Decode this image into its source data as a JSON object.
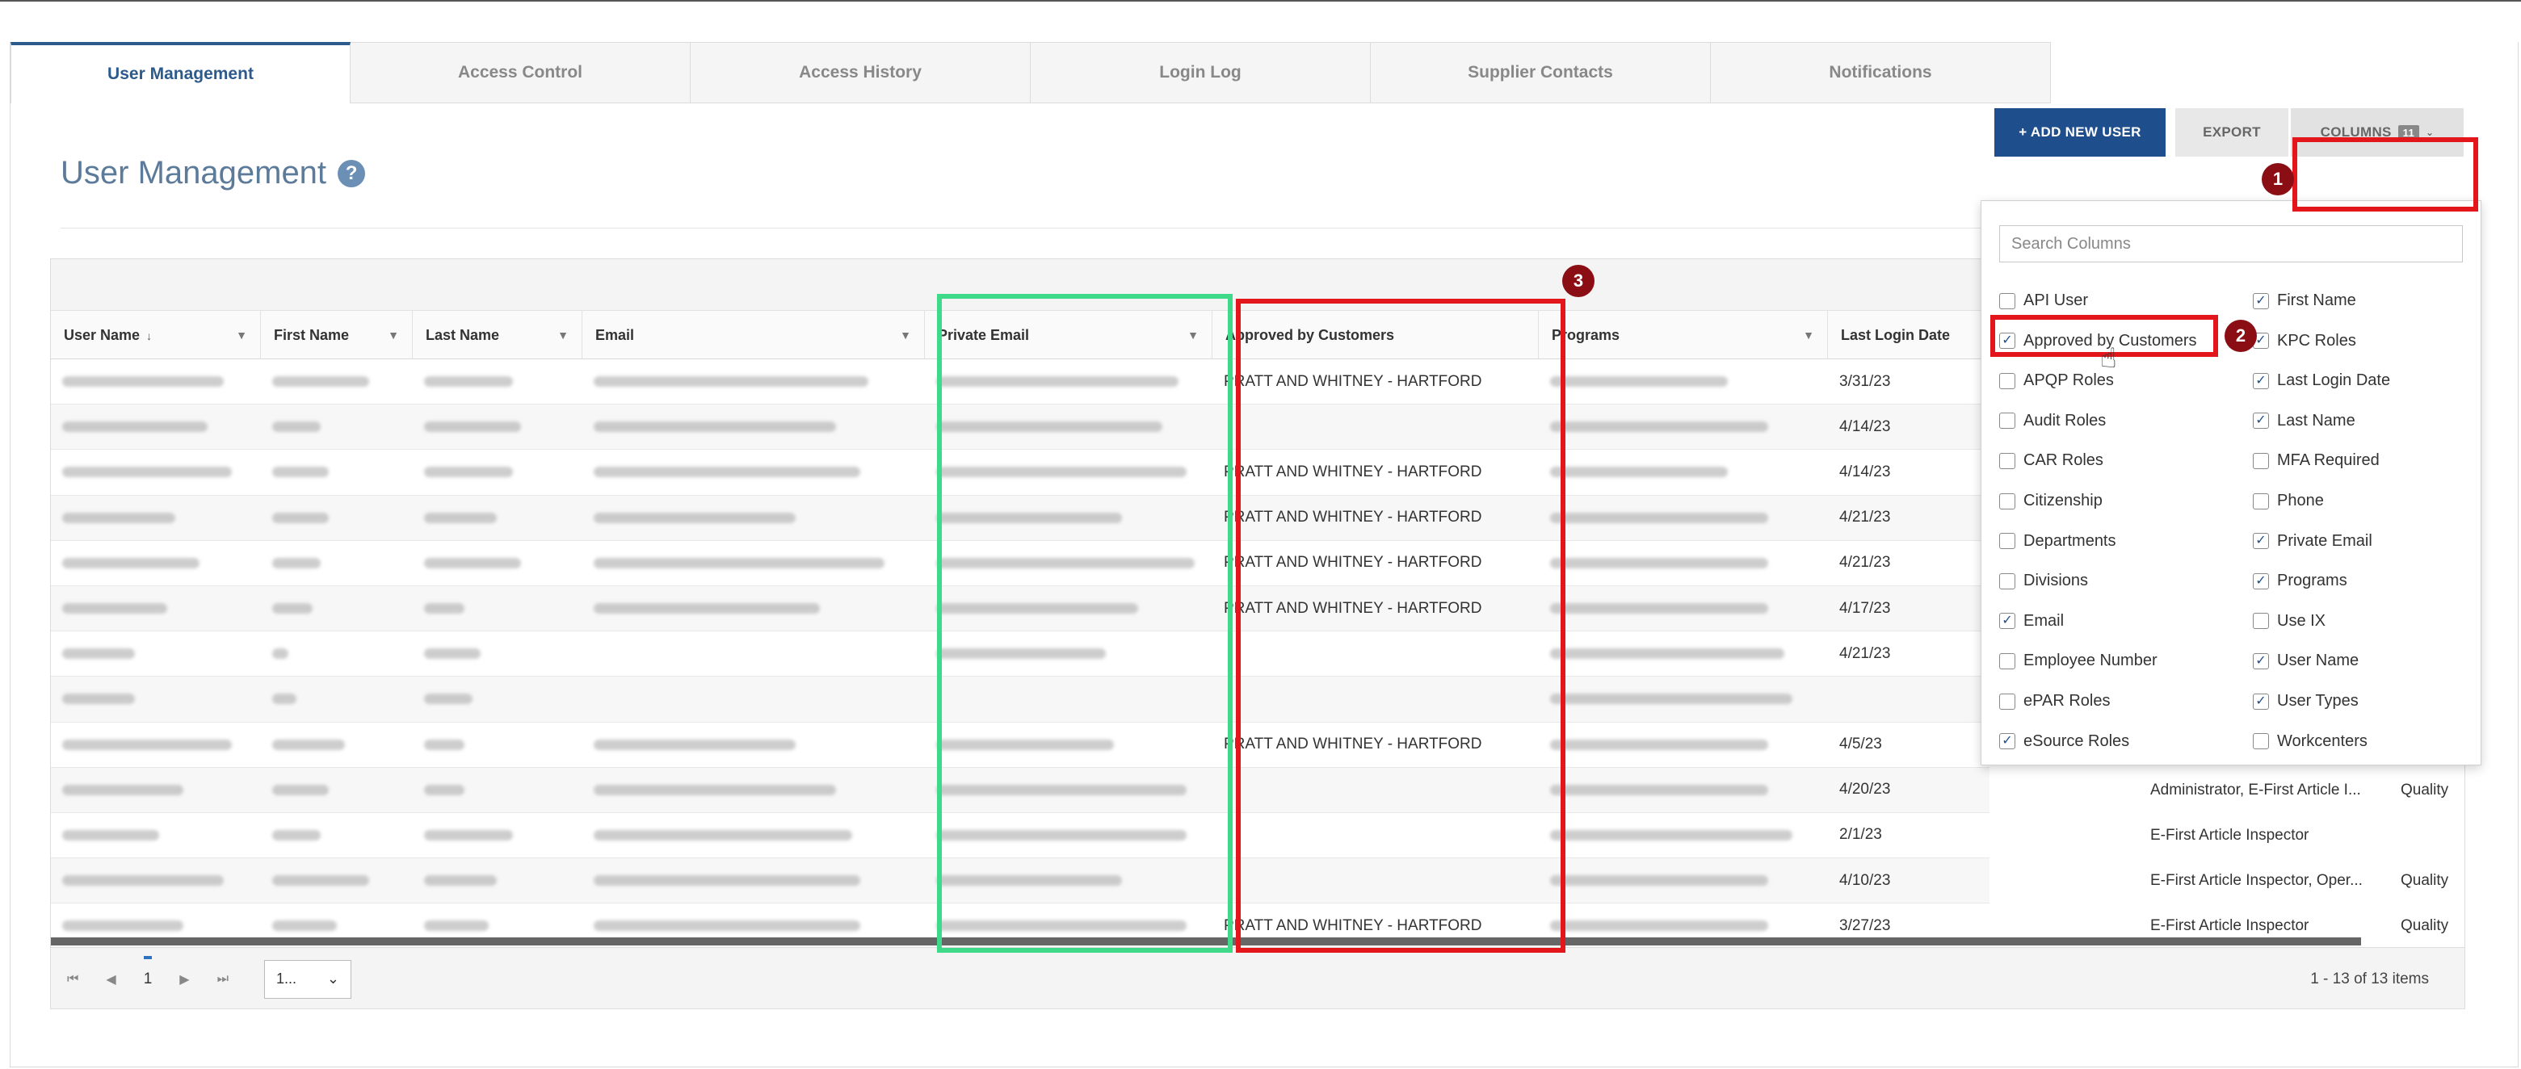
{
  "tabs": [
    {
      "label": "User Management",
      "active": true
    },
    {
      "label": "Access Control",
      "active": false
    },
    {
      "label": "Access History",
      "active": false
    },
    {
      "label": "Login Log",
      "active": false
    },
    {
      "label": "Supplier Contacts",
      "active": false
    },
    {
      "label": "Notifications",
      "active": false
    }
  ],
  "page": {
    "title": "User Management",
    "help_icon": "?"
  },
  "toolbar": {
    "add_label": "+ ADD NEW USER",
    "export_label": "EXPORT",
    "columns_label": "COLUMNS",
    "columns_count": "11",
    "caret": "⌄"
  },
  "markers": {
    "m1": "1",
    "m2": "2",
    "m3": "3"
  },
  "grid": {
    "headers": {
      "user_name": "User Name",
      "first_name": "First Name",
      "last_name": "Last Name",
      "email": "Email",
      "private_email": "Private Email",
      "approved_by_customers": "Approved by Customers",
      "programs": "Programs",
      "last_login_date": "Last Login Date"
    },
    "rows": [
      {
        "approved": "PRATT AND WHITNEY - HARTFORD",
        "last_login": "3/31/23"
      },
      {
        "approved": "",
        "last_login": "4/14/23"
      },
      {
        "approved": "PRATT AND WHITNEY - HARTFORD",
        "last_login": "4/14/23"
      },
      {
        "approved": "PRATT AND WHITNEY - HARTFORD",
        "last_login": "4/21/23"
      },
      {
        "approved": "PRATT AND WHITNEY - HARTFORD",
        "last_login": "4/21/23"
      },
      {
        "approved": "PRATT AND WHITNEY - HARTFORD",
        "last_login": "4/17/23"
      },
      {
        "approved": "",
        "last_login": "4/21/23"
      },
      {
        "approved": "",
        "last_login": ""
      },
      {
        "approved": "PRATT AND WHITNEY - HARTFORD",
        "last_login": "4/5/23"
      },
      {
        "approved": "",
        "last_login": "4/20/23",
        "user_types": "Administrator, E-First Article I...",
        "extra": "Quality"
      },
      {
        "approved": "",
        "last_login": "2/1/23",
        "user_types": "E-First Article Inspector",
        "extra": ""
      },
      {
        "approved": "",
        "last_login": "4/10/23",
        "user_types": "E-First Article Inspector, Oper...",
        "extra": "Quality"
      },
      {
        "approved": "PRATT AND WHITNEY - HARTFORD",
        "last_login": "3/27/23",
        "user_types": "E-First Article Inspector",
        "extra": "Quality"
      }
    ],
    "footer": {
      "first": "⏮",
      "prev": "◀",
      "page": "1",
      "next": "▶",
      "last": "⏭",
      "page_size": "1...",
      "page_size_caret": "⌄",
      "items": "1 - 13 of 13 items"
    }
  },
  "columns_panel": {
    "search_placeholder": "Search Columns",
    "left": [
      {
        "label": "API User",
        "checked": false
      },
      {
        "label": "Approved by Customers",
        "checked": true
      },
      {
        "label": "APQP Roles",
        "checked": false
      },
      {
        "label": "Audit Roles",
        "checked": false
      },
      {
        "label": "CAR Roles",
        "checked": false
      },
      {
        "label": "Citizenship",
        "checked": false
      },
      {
        "label": "Departments",
        "checked": false
      },
      {
        "label": "Divisions",
        "checked": false
      },
      {
        "label": "Email",
        "checked": true
      },
      {
        "label": "Employee Number",
        "checked": false
      },
      {
        "label": "ePAR Roles",
        "checked": false
      },
      {
        "label": "eSource Roles",
        "checked": true
      }
    ],
    "right": [
      {
        "label": "First Name",
        "checked": true
      },
      {
        "label": "KPC Roles",
        "checked": true
      },
      {
        "label": "Last Login Date",
        "checked": true
      },
      {
        "label": "Last Name",
        "checked": true
      },
      {
        "label": "MFA Required",
        "checked": false
      },
      {
        "label": "Phone",
        "checked": false
      },
      {
        "label": "Private Email",
        "checked": true
      },
      {
        "label": "Programs",
        "checked": true
      },
      {
        "label": "Use IX",
        "checked": false
      },
      {
        "label": "User Name",
        "checked": true
      },
      {
        "label": "User Types",
        "checked": true
      },
      {
        "label": "Workcenters",
        "checked": false
      }
    ]
  },
  "colors": {
    "accent": "#1f4e8c",
    "highlight_red": "#e3161b",
    "highlight_green": "#3fd98a",
    "marker": "#8a0e14"
  }
}
